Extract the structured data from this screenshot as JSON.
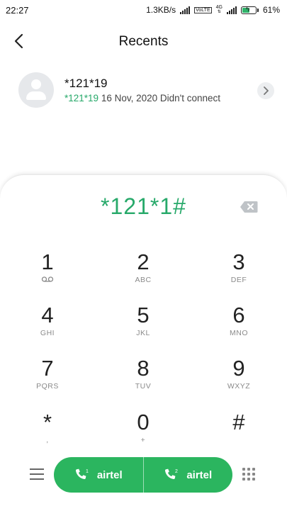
{
  "status": {
    "time": "22:27",
    "speed": "1.3KB/s",
    "volte": "VoLTE",
    "network": "4G",
    "battery": "61%",
    "battery_level": 0.61
  },
  "header": {
    "title": "Recents"
  },
  "recent": {
    "number": "*121*19",
    "sub_number": "*121*19",
    "sub_detail": "16 Nov, 2020 Didn't connect"
  },
  "dialpad": {
    "input": "*121*1#",
    "keys": [
      {
        "digit": "1",
        "letters": "voicemail-icon"
      },
      {
        "digit": "2",
        "letters": "ABC"
      },
      {
        "digit": "3",
        "letters": "DEF"
      },
      {
        "digit": "4",
        "letters": "GHI"
      },
      {
        "digit": "5",
        "letters": "JKL"
      },
      {
        "digit": "6",
        "letters": "MNO"
      },
      {
        "digit": "7",
        "letters": "PQRS"
      },
      {
        "digit": "8",
        "letters": "TUV"
      },
      {
        "digit": "9",
        "letters": "WXYZ"
      },
      {
        "digit": "*",
        "letters": ","
      },
      {
        "digit": "0",
        "letters": "+"
      },
      {
        "digit": "#",
        "letters": ""
      }
    ]
  },
  "call": {
    "sim1_label": "airtel",
    "sim1_slot": "1",
    "sim2_label": "airtel",
    "sim2_slot": "2"
  },
  "colors": {
    "accent": "#27a96a",
    "call": "#2bb55f"
  }
}
